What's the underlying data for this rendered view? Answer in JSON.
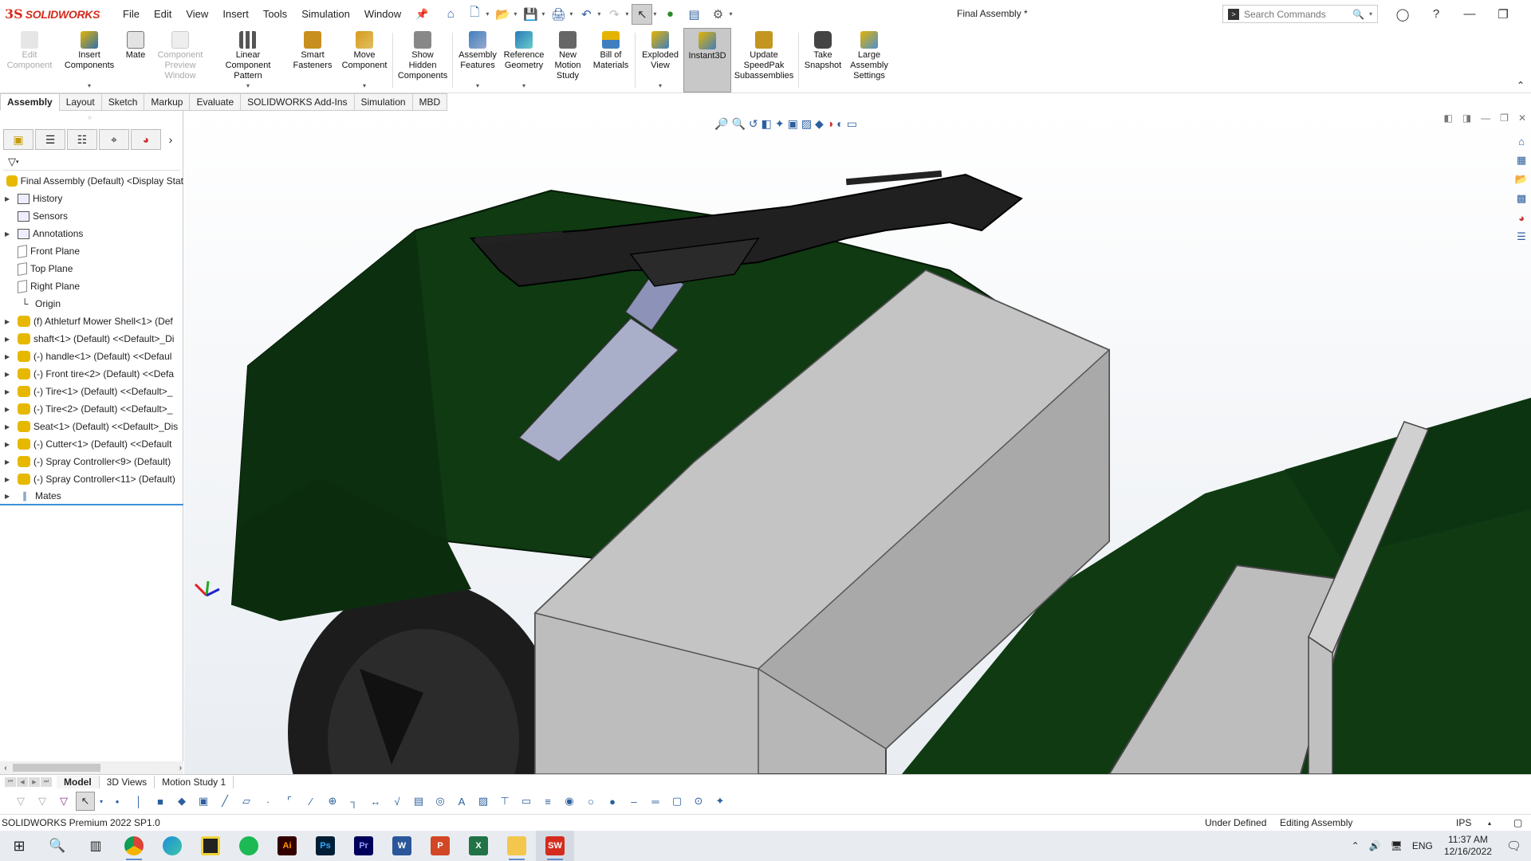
{
  "app": {
    "logo_mark": "3S",
    "logo_text": "SOLIDWORKS",
    "document_title": "Final Assembly *"
  },
  "menu": [
    "File",
    "Edit",
    "View",
    "Insert",
    "Tools",
    "Simulation",
    "Window"
  ],
  "search": {
    "placeholder": "Search Commands"
  },
  "commands": [
    {
      "label": "Edit Component",
      "icon": "edit-component-icon",
      "disabled": true
    },
    {
      "label": "Insert Components",
      "icon": "insert-components-icon",
      "disabled": false
    },
    {
      "label": "Mate",
      "icon": "mate-icon",
      "disabled": false
    },
    {
      "label": "Component Preview Window",
      "icon": "component-preview-icon",
      "disabled": true
    },
    {
      "label": "Linear Component Pattern",
      "icon": "linear-pattern-icon",
      "disabled": false
    },
    {
      "label": "Smart Fasteners",
      "icon": "smart-fasteners-icon",
      "disabled": false
    },
    {
      "label": "Move Component",
      "icon": "move-component-icon",
      "disabled": false
    },
    {
      "label": "Show Hidden Components",
      "icon": "show-hidden-icon",
      "disabled": false
    },
    {
      "label": "Assembly Features",
      "icon": "assembly-features-icon",
      "disabled": false
    },
    {
      "label": "Reference Geometry",
      "icon": "reference-geometry-icon",
      "disabled": false
    },
    {
      "label": "New Motion Study",
      "icon": "motion-study-icon",
      "disabled": false
    },
    {
      "label": "Bill of Materials",
      "icon": "bom-icon",
      "disabled": false
    },
    {
      "label": "Exploded View",
      "icon": "exploded-view-icon",
      "disabled": false
    },
    {
      "label": "Instant3D",
      "icon": "instant3d-icon",
      "disabled": false,
      "active": true
    },
    {
      "label": "Update SpeedPak Subassemblies",
      "icon": "speedpak-icon",
      "disabled": false
    },
    {
      "label": "Take Snapshot",
      "icon": "snapshot-icon",
      "disabled": false
    },
    {
      "label": "Large Assembly Settings",
      "icon": "large-assembly-icon",
      "disabled": false
    }
  ],
  "ribbon_tabs": [
    "Assembly",
    "Layout",
    "Sketch",
    "Markup",
    "Evaluate",
    "SOLIDWORKS Add-Ins",
    "Simulation",
    "MBD"
  ],
  "tree": {
    "root": "Final Assembly (Default) <Display Stat",
    "items": [
      {
        "label": "History",
        "icon": "history-icon",
        "expandable": true
      },
      {
        "label": "Sensors",
        "icon": "sensors-icon",
        "expandable": false
      },
      {
        "label": "Annotations",
        "icon": "annotations-icon",
        "expandable": true
      },
      {
        "label": "Front Plane",
        "icon": "plane-icon",
        "expandable": false
      },
      {
        "label": "Top Plane",
        "icon": "plane-icon",
        "expandable": false
      },
      {
        "label": "Right Plane",
        "icon": "plane-icon",
        "expandable": false
      },
      {
        "label": "Origin",
        "icon": "origin-icon",
        "expandable": false
      },
      {
        "label": "(f) Athleturf Mower Shell<1> (Def",
        "icon": "part-icon",
        "expandable": true
      },
      {
        "label": "shaft<1> (Default) <<Default>_Di",
        "icon": "part-icon",
        "expandable": true
      },
      {
        "label": "(-) handle<1> (Default) <<Defaul",
        "icon": "part-icon",
        "expandable": true
      },
      {
        "label": "(-) Front tire<2> (Default) <<Defa",
        "icon": "part-icon",
        "expandable": true
      },
      {
        "label": "(-) Tire<1> (Default) <<Default>_",
        "icon": "part-icon",
        "expandable": true
      },
      {
        "label": "(-) Tire<2> (Default) <<Default>_",
        "icon": "part-icon",
        "expandable": true
      },
      {
        "label": "Seat<1> (Default) <<Default>_Dis",
        "icon": "part-icon",
        "expandable": true
      },
      {
        "label": "(-) Cutter<1> (Default) <<Default",
        "icon": "part-icon",
        "expandable": true
      },
      {
        "label": "(-) Spray Controller<9> (Default)",
        "icon": "part-icon",
        "expandable": true
      },
      {
        "label": "(-) Spray Controller<11> (Default)",
        "icon": "part-icon",
        "expandable": true
      },
      {
        "label": "Mates",
        "icon": "mates-icon",
        "expandable": true
      }
    ]
  },
  "bottom_tabs": [
    "Model",
    "3D Views",
    "Motion Study 1"
  ],
  "status": {
    "product": "SOLIDWORKS Premium 2022 SP1.0",
    "definition": "Under Defined",
    "mode": "Editing Assembly",
    "units": "IPS"
  },
  "taskbar": {
    "apps": [
      "Chrome",
      "Edge",
      "Notepad",
      "Spotify",
      "Illustrator",
      "Photoshop",
      "Premiere",
      "Word",
      "PowerPoint",
      "Excel",
      "File Explorer",
      "SOLIDWORKS 2022"
    ],
    "app_labels": [
      "",
      "",
      "",
      "",
      "Ai",
      "Ps",
      "Pr",
      "W",
      "P",
      "X",
      "",
      "SW"
    ],
    "language": "ENG",
    "time": "11:37 AM",
    "date": "12/16/2022"
  },
  "colors": {
    "brand": "#d52b1e",
    "shell_green": "#0f3a12",
    "part_gray": "#b7b7b7",
    "viewport_bg": "#e9edf2"
  }
}
